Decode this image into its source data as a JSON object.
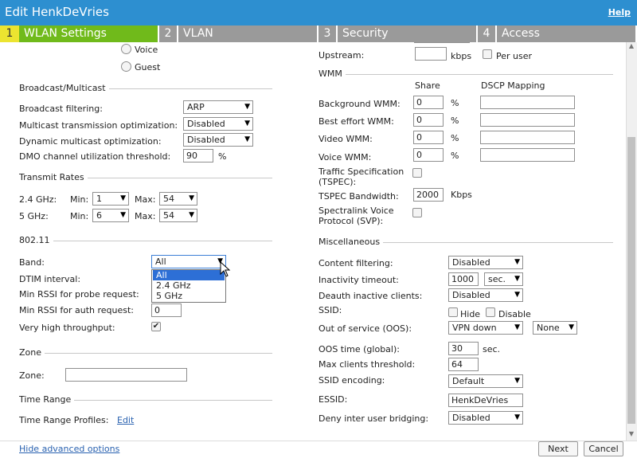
{
  "window": {
    "title": "Edit HenkDeVries",
    "help": "Help"
  },
  "tabs": [
    {
      "num": "1",
      "label": "WLAN Settings",
      "active": true
    },
    {
      "num": "2",
      "label": "VLAN"
    },
    {
      "num": "3",
      "label": "Security"
    },
    {
      "num": "4",
      "label": "Access"
    }
  ],
  "left": {
    "radio_voice": "Voice",
    "radio_guest": "Guest",
    "broadcast": {
      "heading": "Broadcast/Multicast",
      "bf_label": "Broadcast filtering:",
      "bf_value": "ARP",
      "mto_label": "Multicast transmission optimization:",
      "mto_value": "Disabled",
      "dmo_label": "Dynamic multicast optimization:",
      "dmo_value": "Disabled",
      "dmo_thr_label": "DMO channel utilization threshold:",
      "dmo_thr_value": "90",
      "dmo_thr_unit": "%"
    },
    "transmit": {
      "heading": "Transmit Rates",
      "g24": "2.4 GHz:",
      "g5": "5 GHz:",
      "min": "Min:",
      "max": "Max:",
      "g24_min": "1",
      "g24_max": "54",
      "g5_min": "6",
      "g5_max": "54"
    },
    "dot11": {
      "heading": "802.11",
      "band_label": "Band:",
      "band_value": "All",
      "band_options": [
        "All",
        "2.4 GHz",
        "5 GHz"
      ],
      "dtim_label": "DTIM interval:",
      "rssi_probe_label": "Min RSSI for probe request:",
      "rssi_auth_label": "Min RSSI for auth request:",
      "rssi_auth_value": "0",
      "vht_label": "Very high throughput:",
      "vht_check": "✔"
    },
    "zone": {
      "heading": "Zone",
      "label": "Zone:",
      "value": ""
    },
    "timerange": {
      "heading": "Time Range",
      "label": "Time Range Profiles:",
      "edit": "Edit"
    }
  },
  "right": {
    "upstream_label": "Upstream:",
    "upstream_value": "",
    "upstream_unit": "kbps",
    "per_user": "Per user",
    "wmm": {
      "heading": "WMM",
      "share": "Share",
      "dscp": "DSCP Mapping",
      "rows": [
        {
          "label": "Background WMM:",
          "share": "0",
          "unit": "%",
          "dscp": ""
        },
        {
          "label": "Best effort WMM:",
          "share": "0",
          "unit": "%",
          "dscp": ""
        },
        {
          "label": "Video WMM:",
          "share": "0",
          "unit": "%",
          "dscp": ""
        },
        {
          "label": "Voice WMM:",
          "share": "0",
          "unit": "%",
          "dscp": ""
        }
      ],
      "tspec_label1": "Traffic Specification",
      "tspec_label2": "(TSPEC):",
      "tspec_bw_label": "TSPEC Bandwidth:",
      "tspec_bw_value": "2000",
      "tspec_bw_unit": "Kbps",
      "svp_label1": "Spectralink Voice",
      "svp_label2": "Protocol (SVP):"
    },
    "misc": {
      "heading": "Miscellaneous",
      "cf_label": "Content filtering:",
      "cf_value": "Disabled",
      "it_label": "Inactivity timeout:",
      "it_value": "1000",
      "it_unit": "sec.",
      "deauth_label": "Deauth inactive clients:",
      "deauth_value": "Disabled",
      "ssid_label": "SSID:",
      "hide": "Hide",
      "disable": "Disable",
      "oos_label": "Out of service (OOS):",
      "oos_value": "VPN down",
      "oos_value2": "None",
      "oos_time_label": "OOS time (global):",
      "oos_time_value": "30",
      "oos_time_unit": "sec.",
      "max_clients_label": "Max clients threshold:",
      "max_clients_value": "64",
      "ssid_enc_label": "SSID encoding:",
      "ssid_enc_value": "Default",
      "essid_label": "ESSID:",
      "essid_value": "HenkDeVries",
      "deny_label": "Deny inter user bridging:",
      "deny_value": "Disabled"
    }
  },
  "footer": {
    "hide_adv": "Hide advanced options",
    "next": "Next",
    "cancel": "Cancel"
  },
  "colors": {
    "titlebar": "#2d8fd0",
    "tab_active": "#70ba1b",
    "tab_num_active": "#ece430",
    "tab_inactive": "#9a9a9a",
    "link": "#2a62b0"
  }
}
